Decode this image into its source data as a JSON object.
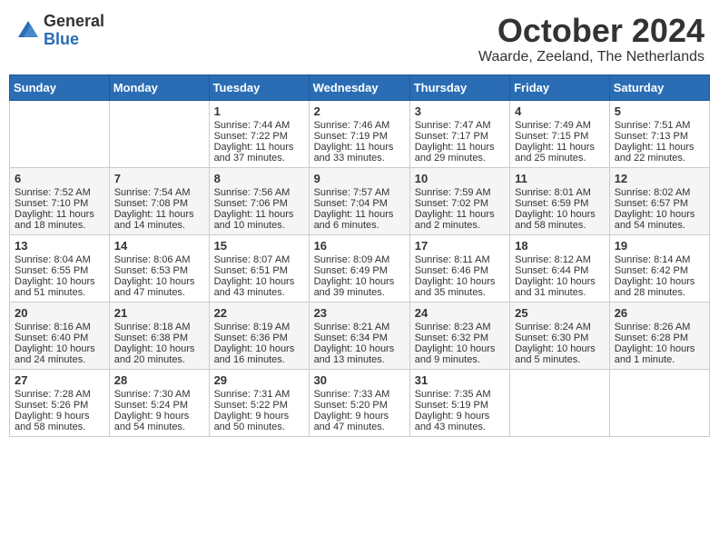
{
  "header": {
    "logo_general": "General",
    "logo_blue": "Blue",
    "month_title": "October 2024",
    "location": "Waarde, Zeeland, The Netherlands"
  },
  "days_of_week": [
    "Sunday",
    "Monday",
    "Tuesday",
    "Wednesday",
    "Thursday",
    "Friday",
    "Saturday"
  ],
  "weeks": [
    [
      {
        "day": "",
        "sunrise": "",
        "sunset": "",
        "daylight": ""
      },
      {
        "day": "",
        "sunrise": "",
        "sunset": "",
        "daylight": ""
      },
      {
        "day": "1",
        "sunrise": "Sunrise: 7:44 AM",
        "sunset": "Sunset: 7:22 PM",
        "daylight": "Daylight: 11 hours and 37 minutes."
      },
      {
        "day": "2",
        "sunrise": "Sunrise: 7:46 AM",
        "sunset": "Sunset: 7:19 PM",
        "daylight": "Daylight: 11 hours and 33 minutes."
      },
      {
        "day": "3",
        "sunrise": "Sunrise: 7:47 AM",
        "sunset": "Sunset: 7:17 PM",
        "daylight": "Daylight: 11 hours and 29 minutes."
      },
      {
        "day": "4",
        "sunrise": "Sunrise: 7:49 AM",
        "sunset": "Sunset: 7:15 PM",
        "daylight": "Daylight: 11 hours and 25 minutes."
      },
      {
        "day": "5",
        "sunrise": "Sunrise: 7:51 AM",
        "sunset": "Sunset: 7:13 PM",
        "daylight": "Daylight: 11 hours and 22 minutes."
      }
    ],
    [
      {
        "day": "6",
        "sunrise": "Sunrise: 7:52 AM",
        "sunset": "Sunset: 7:10 PM",
        "daylight": "Daylight: 11 hours and 18 minutes."
      },
      {
        "day": "7",
        "sunrise": "Sunrise: 7:54 AM",
        "sunset": "Sunset: 7:08 PM",
        "daylight": "Daylight: 11 hours and 14 minutes."
      },
      {
        "day": "8",
        "sunrise": "Sunrise: 7:56 AM",
        "sunset": "Sunset: 7:06 PM",
        "daylight": "Daylight: 11 hours and 10 minutes."
      },
      {
        "day": "9",
        "sunrise": "Sunrise: 7:57 AM",
        "sunset": "Sunset: 7:04 PM",
        "daylight": "Daylight: 11 hours and 6 minutes."
      },
      {
        "day": "10",
        "sunrise": "Sunrise: 7:59 AM",
        "sunset": "Sunset: 7:02 PM",
        "daylight": "Daylight: 11 hours and 2 minutes."
      },
      {
        "day": "11",
        "sunrise": "Sunrise: 8:01 AM",
        "sunset": "Sunset: 6:59 PM",
        "daylight": "Daylight: 10 hours and 58 minutes."
      },
      {
        "day": "12",
        "sunrise": "Sunrise: 8:02 AM",
        "sunset": "Sunset: 6:57 PM",
        "daylight": "Daylight: 10 hours and 54 minutes."
      }
    ],
    [
      {
        "day": "13",
        "sunrise": "Sunrise: 8:04 AM",
        "sunset": "Sunset: 6:55 PM",
        "daylight": "Daylight: 10 hours and 51 minutes."
      },
      {
        "day": "14",
        "sunrise": "Sunrise: 8:06 AM",
        "sunset": "Sunset: 6:53 PM",
        "daylight": "Daylight: 10 hours and 47 minutes."
      },
      {
        "day": "15",
        "sunrise": "Sunrise: 8:07 AM",
        "sunset": "Sunset: 6:51 PM",
        "daylight": "Daylight: 10 hours and 43 minutes."
      },
      {
        "day": "16",
        "sunrise": "Sunrise: 8:09 AM",
        "sunset": "Sunset: 6:49 PM",
        "daylight": "Daylight: 10 hours and 39 minutes."
      },
      {
        "day": "17",
        "sunrise": "Sunrise: 8:11 AM",
        "sunset": "Sunset: 6:46 PM",
        "daylight": "Daylight: 10 hours and 35 minutes."
      },
      {
        "day": "18",
        "sunrise": "Sunrise: 8:12 AM",
        "sunset": "Sunset: 6:44 PM",
        "daylight": "Daylight: 10 hours and 31 minutes."
      },
      {
        "day": "19",
        "sunrise": "Sunrise: 8:14 AM",
        "sunset": "Sunset: 6:42 PM",
        "daylight": "Daylight: 10 hours and 28 minutes."
      }
    ],
    [
      {
        "day": "20",
        "sunrise": "Sunrise: 8:16 AM",
        "sunset": "Sunset: 6:40 PM",
        "daylight": "Daylight: 10 hours and 24 minutes."
      },
      {
        "day": "21",
        "sunrise": "Sunrise: 8:18 AM",
        "sunset": "Sunset: 6:38 PM",
        "daylight": "Daylight: 10 hours and 20 minutes."
      },
      {
        "day": "22",
        "sunrise": "Sunrise: 8:19 AM",
        "sunset": "Sunset: 6:36 PM",
        "daylight": "Daylight: 10 hours and 16 minutes."
      },
      {
        "day": "23",
        "sunrise": "Sunrise: 8:21 AM",
        "sunset": "Sunset: 6:34 PM",
        "daylight": "Daylight: 10 hours and 13 minutes."
      },
      {
        "day": "24",
        "sunrise": "Sunrise: 8:23 AM",
        "sunset": "Sunset: 6:32 PM",
        "daylight": "Daylight: 10 hours and 9 minutes."
      },
      {
        "day": "25",
        "sunrise": "Sunrise: 8:24 AM",
        "sunset": "Sunset: 6:30 PM",
        "daylight": "Daylight: 10 hours and 5 minutes."
      },
      {
        "day": "26",
        "sunrise": "Sunrise: 8:26 AM",
        "sunset": "Sunset: 6:28 PM",
        "daylight": "Daylight: 10 hours and 1 minute."
      }
    ],
    [
      {
        "day": "27",
        "sunrise": "Sunrise: 7:28 AM",
        "sunset": "Sunset: 5:26 PM",
        "daylight": "Daylight: 9 hours and 58 minutes."
      },
      {
        "day": "28",
        "sunrise": "Sunrise: 7:30 AM",
        "sunset": "Sunset: 5:24 PM",
        "daylight": "Daylight: 9 hours and 54 minutes."
      },
      {
        "day": "29",
        "sunrise": "Sunrise: 7:31 AM",
        "sunset": "Sunset: 5:22 PM",
        "daylight": "Daylight: 9 hours and 50 minutes."
      },
      {
        "day": "30",
        "sunrise": "Sunrise: 7:33 AM",
        "sunset": "Sunset: 5:20 PM",
        "daylight": "Daylight: 9 hours and 47 minutes."
      },
      {
        "day": "31",
        "sunrise": "Sunrise: 7:35 AM",
        "sunset": "Sunset: 5:19 PM",
        "daylight": "Daylight: 9 hours and 43 minutes."
      },
      {
        "day": "",
        "sunrise": "",
        "sunset": "",
        "daylight": ""
      },
      {
        "day": "",
        "sunrise": "",
        "sunset": "",
        "daylight": ""
      }
    ]
  ]
}
